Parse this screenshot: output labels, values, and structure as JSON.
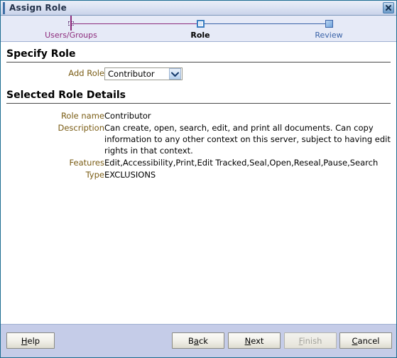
{
  "window": {
    "title": "Assign Role",
    "close_icon": "close-icon"
  },
  "train": {
    "steps": [
      {
        "label": "Users/Groups",
        "state": "done"
      },
      {
        "label": "Role",
        "state": "current"
      },
      {
        "label": "Review",
        "state": "todo"
      }
    ],
    "colors": {
      "done": "#8d2b7c",
      "current": "#000000",
      "todo": "#3a63a8"
    }
  },
  "specify_role": {
    "heading": "Specify Role",
    "add_role": {
      "label": "Add Role",
      "value": "Contributor",
      "options": [
        "Contributor"
      ],
      "arrow_icon": "chevron-down-icon"
    }
  },
  "selected_role_details": {
    "heading": "Selected Role Details",
    "fields": [
      {
        "label": "Role name",
        "value": "Contributor"
      },
      {
        "label": "Description",
        "value": "Can create, open, search, edit, and print all documents. Can copy information to any other context on this server, subject to having edit rights in that context."
      },
      {
        "label": "Features",
        "value": "Edit,Accessibility,Print,Edit Tracked,Seal,Open,Reseal,Pause,Search"
      },
      {
        "label": "Type",
        "value": "EXCLUSIONS"
      }
    ]
  },
  "footer": {
    "help": {
      "pre": "",
      "key": "H",
      "post": "elp"
    },
    "back": {
      "pre": "B",
      "key": "a",
      "post": "ck"
    },
    "next": {
      "pre": "",
      "key": "N",
      "post": "ext"
    },
    "finish": {
      "pre": "",
      "key": "F",
      "post": "inish",
      "disabled": true
    },
    "cancel": {
      "pre": "",
      "key": "C",
      "post": "ancel"
    }
  }
}
